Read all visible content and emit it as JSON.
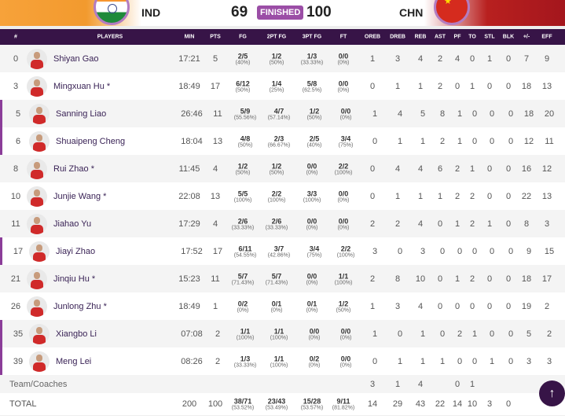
{
  "header": {
    "home": "IND",
    "home_score": "69",
    "status": "FINISHED",
    "away_score": "100",
    "away": "CHN"
  },
  "columns": [
    "#",
    "PLAYERS",
    "MIN",
    "PTS",
    "FG",
    "2PT FG",
    "3PT FG",
    "FT",
    "OREB",
    "DREB",
    "REB",
    "AST",
    "PF",
    "TO",
    "STL",
    "BLK",
    "+/-",
    "EFF"
  ],
  "players": [
    {
      "no": "0",
      "name": "Shiyan Gao",
      "min": "17:21",
      "pts": "5",
      "fg": [
        "2/5",
        "(40%)"
      ],
      "p2": [
        "1/2",
        "(50%)"
      ],
      "p3": [
        "1/3",
        "(33.33%)"
      ],
      "ft": [
        "0/0",
        "(0%)"
      ],
      "s": [
        "1",
        "3",
        "4",
        "2",
        "4",
        "0",
        "1",
        "0",
        "7",
        "9"
      ],
      "mark": false
    },
    {
      "no": "3",
      "name": "Mingxuan Hu *",
      "min": "18:49",
      "pts": "17",
      "fg": [
        "6/12",
        "(50%)"
      ],
      "p2": [
        "1/4",
        "(25%)"
      ],
      "p3": [
        "5/8",
        "(62.5%)"
      ],
      "ft": [
        "0/0",
        "(0%)"
      ],
      "s": [
        "0",
        "1",
        "1",
        "2",
        "0",
        "1",
        "0",
        "0",
        "18",
        "13"
      ],
      "mark": false
    },
    {
      "no": "5",
      "name": "Sanning Liao",
      "min": "26:46",
      "pts": "11",
      "fg": [
        "5/9",
        "(55.56%)"
      ],
      "p2": [
        "4/7",
        "(57.14%)"
      ],
      "p3": [
        "1/2",
        "(50%)"
      ],
      "ft": [
        "0/0",
        "(0%)"
      ],
      "s": [
        "1",
        "4",
        "5",
        "8",
        "1",
        "0",
        "0",
        "0",
        "18",
        "20"
      ],
      "mark": true
    },
    {
      "no": "6",
      "name": "Shuaipeng Cheng",
      "min": "18:04",
      "pts": "13",
      "fg": [
        "4/8",
        "(50%)"
      ],
      "p2": [
        "2/3",
        "(66.67%)"
      ],
      "p3": [
        "2/5",
        "(40%)"
      ],
      "ft": [
        "3/4",
        "(75%)"
      ],
      "s": [
        "0",
        "1",
        "1",
        "2",
        "1",
        "0",
        "0",
        "0",
        "12",
        "11"
      ],
      "mark": true
    },
    {
      "no": "8",
      "name": "Rui Zhao *",
      "min": "11:45",
      "pts": "4",
      "fg": [
        "1/2",
        "(50%)"
      ],
      "p2": [
        "1/2",
        "(50%)"
      ],
      "p3": [
        "0/0",
        "(0%)"
      ],
      "ft": [
        "2/2",
        "(100%)"
      ],
      "s": [
        "0",
        "4",
        "4",
        "6",
        "2",
        "1",
        "0",
        "0",
        "16",
        "12"
      ],
      "mark": false
    },
    {
      "no": "10",
      "name": "Junjie Wang *",
      "min": "22:08",
      "pts": "13",
      "fg": [
        "5/5",
        "(100%)"
      ],
      "p2": [
        "2/2",
        "(100%)"
      ],
      "p3": [
        "3/3",
        "(100%)"
      ],
      "ft": [
        "0/0",
        "(0%)"
      ],
      "s": [
        "0",
        "1",
        "1",
        "1",
        "2",
        "2",
        "0",
        "0",
        "22",
        "13"
      ],
      "mark": false
    },
    {
      "no": "11",
      "name": "Jiahao Yu",
      "min": "17:29",
      "pts": "4",
      "fg": [
        "2/6",
        "(33.33%)"
      ],
      "p2": [
        "2/6",
        "(33.33%)"
      ],
      "p3": [
        "0/0",
        "(0%)"
      ],
      "ft": [
        "0/0",
        "(0%)"
      ],
      "s": [
        "2",
        "2",
        "4",
        "0",
        "1",
        "2",
        "1",
        "0",
        "8",
        "3"
      ],
      "mark": false
    },
    {
      "no": "17",
      "name": "Jiayi Zhao",
      "min": "17:52",
      "pts": "17",
      "fg": [
        "6/11",
        "(54.55%)"
      ],
      "p2": [
        "3/7",
        "(42.86%)"
      ],
      "p3": [
        "3/4",
        "(75%)"
      ],
      "ft": [
        "2/2",
        "(100%)"
      ],
      "s": [
        "3",
        "0",
        "3",
        "0",
        "0",
        "0",
        "0",
        "0",
        "9",
        "15"
      ],
      "mark": true
    },
    {
      "no": "21",
      "name": "Jinqiu Hu *",
      "min": "15:23",
      "pts": "11",
      "fg": [
        "5/7",
        "(71.43%)"
      ],
      "p2": [
        "5/7",
        "(71.43%)"
      ],
      "p3": [
        "0/0",
        "(0%)"
      ],
      "ft": [
        "1/1",
        "(100%)"
      ],
      "s": [
        "2",
        "8",
        "10",
        "0",
        "1",
        "2",
        "0",
        "0",
        "18",
        "17"
      ],
      "mark": false
    },
    {
      "no": "26",
      "name": "Junlong Zhu *",
      "min": "18:49",
      "pts": "1",
      "fg": [
        "0/2",
        "(0%)"
      ],
      "p2": [
        "0/1",
        "(0%)"
      ],
      "p3": [
        "0/1",
        "(0%)"
      ],
      "ft": [
        "1/2",
        "(50%)"
      ],
      "s": [
        "1",
        "3",
        "4",
        "0",
        "0",
        "0",
        "0",
        "0",
        "19",
        "2"
      ],
      "mark": false
    },
    {
      "no": "35",
      "name": "Xiangbo Li",
      "min": "07:08",
      "pts": "2",
      "fg": [
        "1/1",
        "(100%)"
      ],
      "p2": [
        "1/1",
        "(100%)"
      ],
      "p3": [
        "0/0",
        "(0%)"
      ],
      "ft": [
        "0/0",
        "(0%)"
      ],
      "s": [
        "1",
        "0",
        "1",
        "0",
        "2",
        "1",
        "0",
        "0",
        "5",
        "2"
      ],
      "mark": true
    },
    {
      "no": "39",
      "name": "Meng Lei",
      "min": "08:26",
      "pts": "2",
      "fg": [
        "1/3",
        "(33.33%)"
      ],
      "p2": [
        "1/1",
        "(100%)"
      ],
      "p3": [
        "0/2",
        "(0%)"
      ],
      "ft": [
        "0/0",
        "(0%)"
      ],
      "s": [
        "0",
        "1",
        "1",
        "1",
        "0",
        "0",
        "1",
        "0",
        "3",
        "3"
      ],
      "mark": true
    }
  ],
  "team": {
    "label": "Team/Coaches",
    "s": [
      "3",
      "1",
      "4",
      "",
      "0",
      "1",
      "",
      "",
      "",
      ""
    ]
  },
  "total": {
    "label": "TOTAL",
    "min": "200",
    "pts": "100",
    "fg": [
      "38/71",
      "(53.52%)"
    ],
    "p2": [
      "23/43",
      "(53.49%)"
    ],
    "p3": [
      "15/28",
      "(53.57%)"
    ],
    "ft": [
      "9/11",
      "(81.82%)"
    ],
    "s": [
      "14",
      "29",
      "43",
      "22",
      "14",
      "10",
      "3",
      "0",
      "",
      ""
    ]
  },
  "scroll_top": "↑"
}
